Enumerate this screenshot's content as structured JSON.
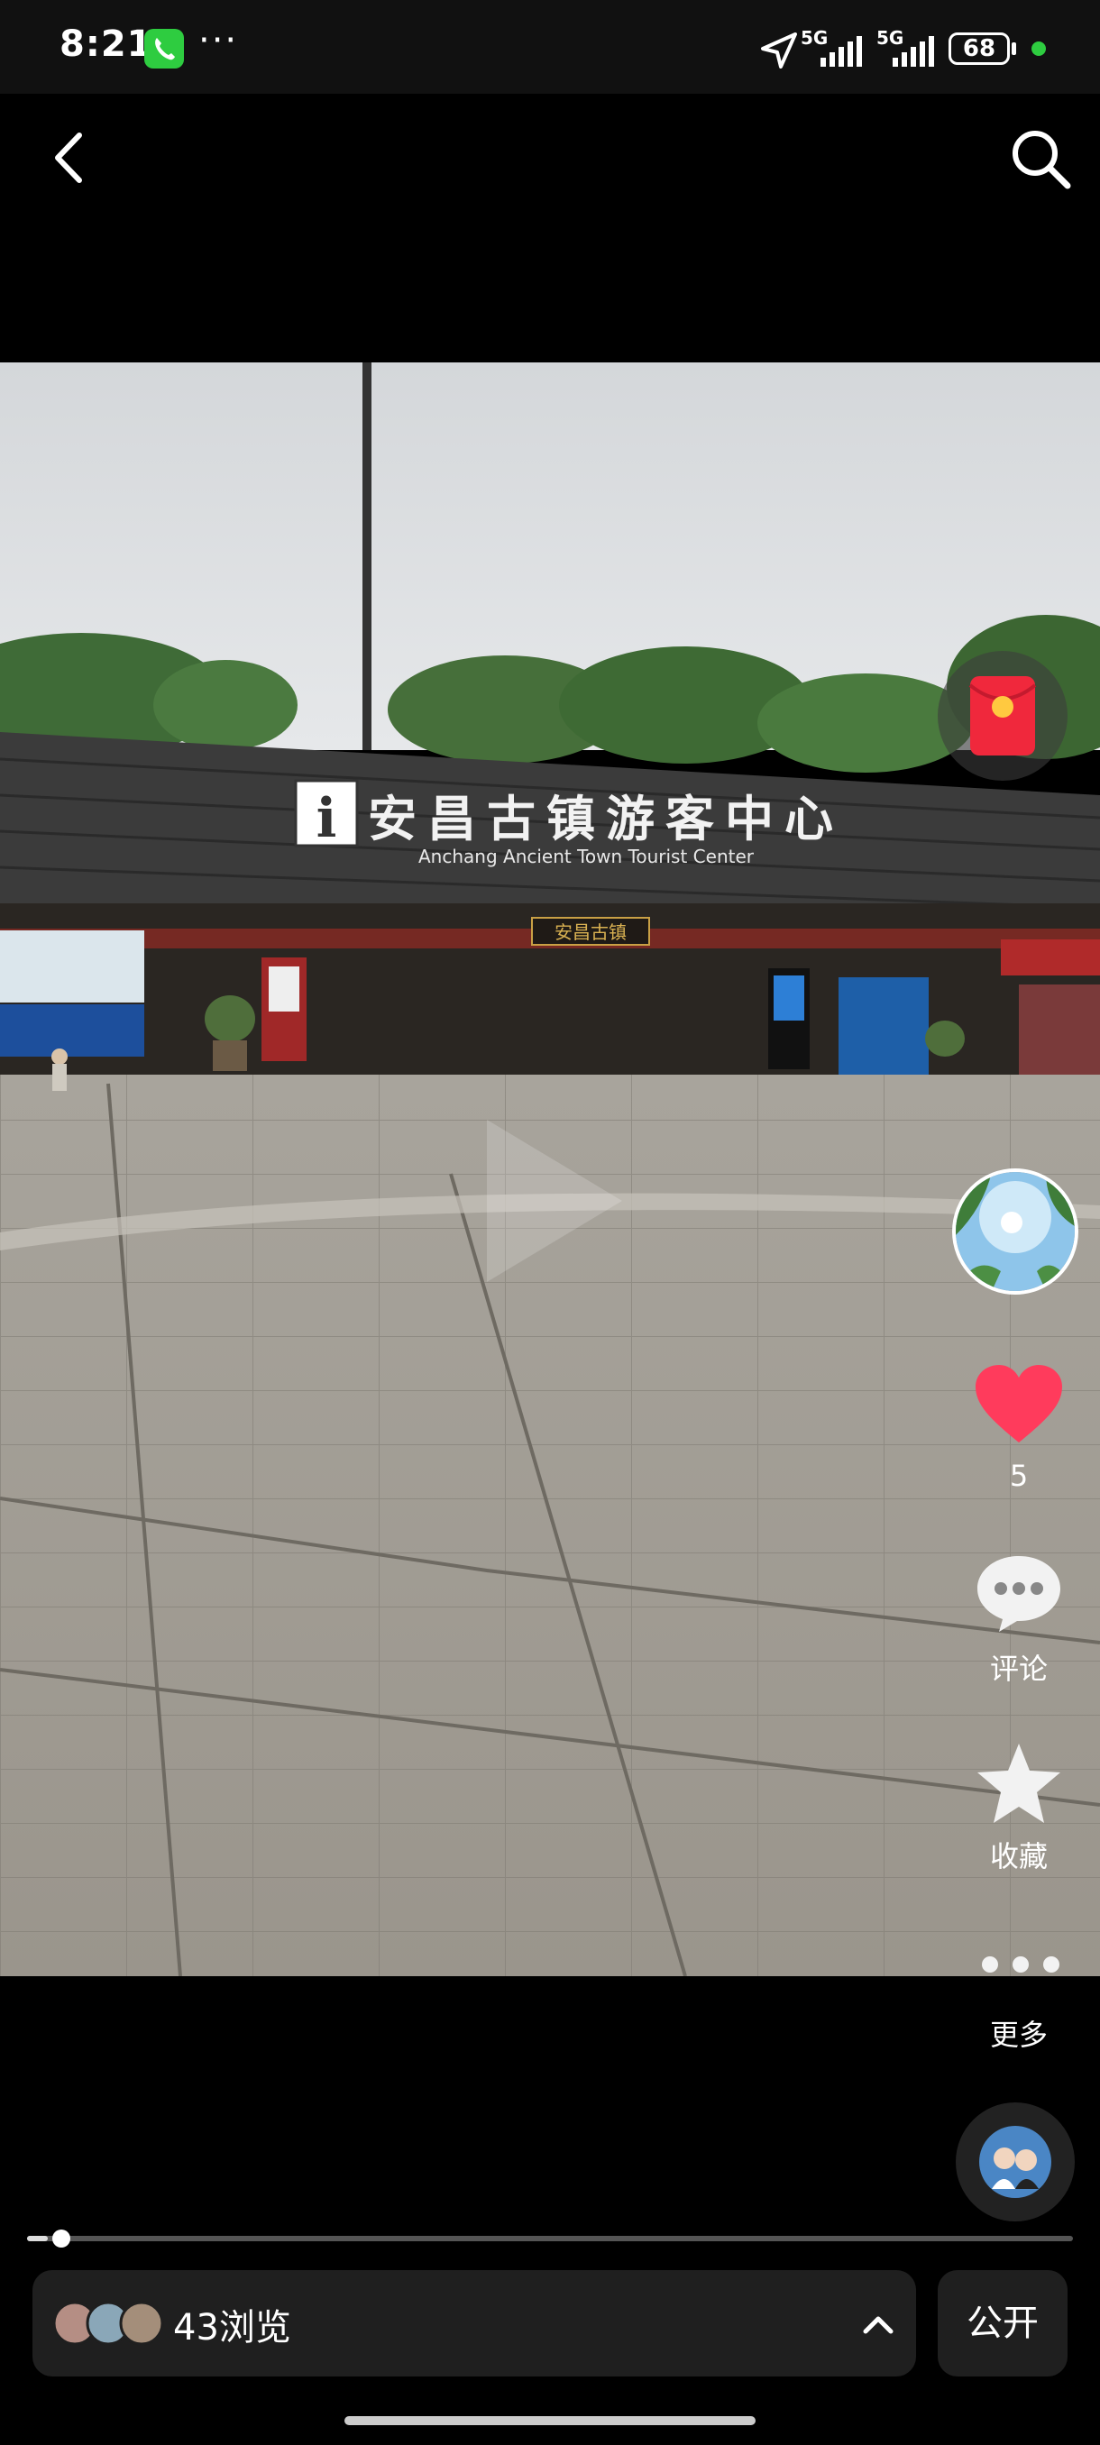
{
  "status_bar": {
    "time": "8:21",
    "more": "···",
    "network1": "5G",
    "network2": "5G",
    "battery": "68"
  },
  "video": {
    "building_sign_cn": "安昌古镇游客中心",
    "building_sign_en": "Anchang Ancient Town Tourist Center",
    "gate_sign": "安昌古镇",
    "progress_fraction": 0.02
  },
  "rail": {
    "like_count": "5",
    "comment_label": "评论",
    "favorite_label": "收藏",
    "more_label": "更多"
  },
  "bottom": {
    "views_label": "43浏览",
    "public_label": "公开"
  },
  "colors": {
    "like_red": "#ff3b5c",
    "status_green": "#2ecc40"
  }
}
